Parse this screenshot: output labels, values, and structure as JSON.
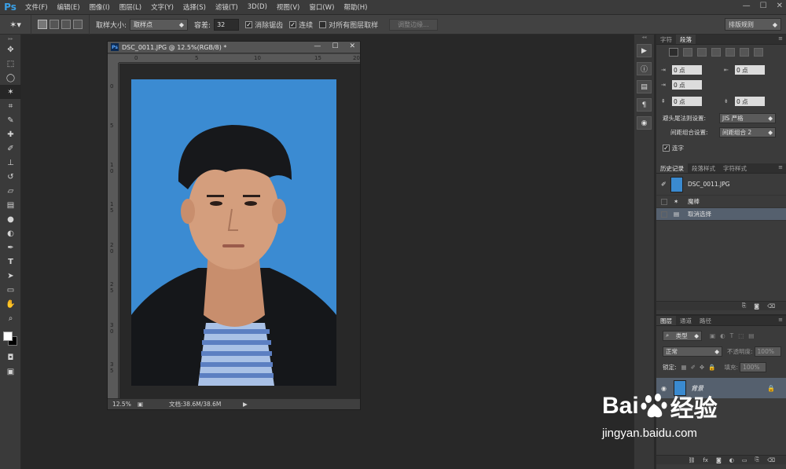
{
  "app": {
    "logo": "Ps"
  },
  "menu": [
    "文件(F)",
    "编辑(E)",
    "图像(I)",
    "图层(L)",
    "文字(Y)",
    "选择(S)",
    "滤镜(T)",
    "3D(D)",
    "视图(V)",
    "窗口(W)",
    "帮助(H)"
  ],
  "options": {
    "tool_icon": "magic-wand-icon",
    "sample_size_label": "取样大小:",
    "sample_size_value": "取样点",
    "tolerance_label": "容差:",
    "tolerance_value": "32",
    "antialias_label": "消除锯齿",
    "antialias_checked": true,
    "contiguous_label": "连续",
    "contiguous_checked": true,
    "sample_all_label": "对所有图层取样",
    "sample_all_checked": false,
    "refine_edge_label": "调整边缘...",
    "workspace": "排版规则"
  },
  "document": {
    "title": "DSC_0011.JPG @ 12.5%(RGB/8) *",
    "zoom": "12.5%",
    "doc_info": "文档:38.6M/38.6M",
    "ruler_top_labels": [
      "0",
      "5",
      "10",
      "15",
      "20"
    ],
    "ruler_left_labels": [
      "0",
      "5",
      "1 0",
      "1 5",
      "2 0",
      "2 5",
      "3 0",
      "3 5"
    ],
    "background_color": "#3a8ad0"
  },
  "paragraph_panel": {
    "tabs": [
      "字符",
      "段落"
    ],
    "active_tab": "段落",
    "indent_left": "0 点",
    "indent_right": "0 点",
    "indent_first": "0 点",
    "space_before": "0 点",
    "space_after": "0 点",
    "kinsoku_label": "避头尾法则设置:",
    "kinsoku_value": "JIS 严格",
    "mojikumi_label": "间距组合设置:",
    "mojikumi_value": "间距组合 2",
    "hyphenate_label": "连字",
    "hyphenate_checked": true
  },
  "history_panel": {
    "tabs": [
      "历史记录",
      "段落样式",
      "字符样式"
    ],
    "active_tab": "历史记录",
    "snapshot": "DSC_0011.JPG",
    "items": [
      "魔棒",
      "取消选择"
    ],
    "selected_item": "取消选择"
  },
  "layers_panel": {
    "tabs": [
      "图层",
      "通道",
      "路径"
    ],
    "active_tab": "图层",
    "filter_label": "类型",
    "blend_mode": "正常",
    "opacity_label": "不透明度:",
    "opacity_value": "100%",
    "lock_label": "锁定:",
    "fill_label": "填充:",
    "fill_value": "100%",
    "layers": [
      {
        "name": "背景",
        "locked": true,
        "visible": true
      }
    ]
  },
  "watermark": {
    "brand": "Bai",
    "brand2": "经验",
    "url": "jingyan.baidu.com"
  }
}
